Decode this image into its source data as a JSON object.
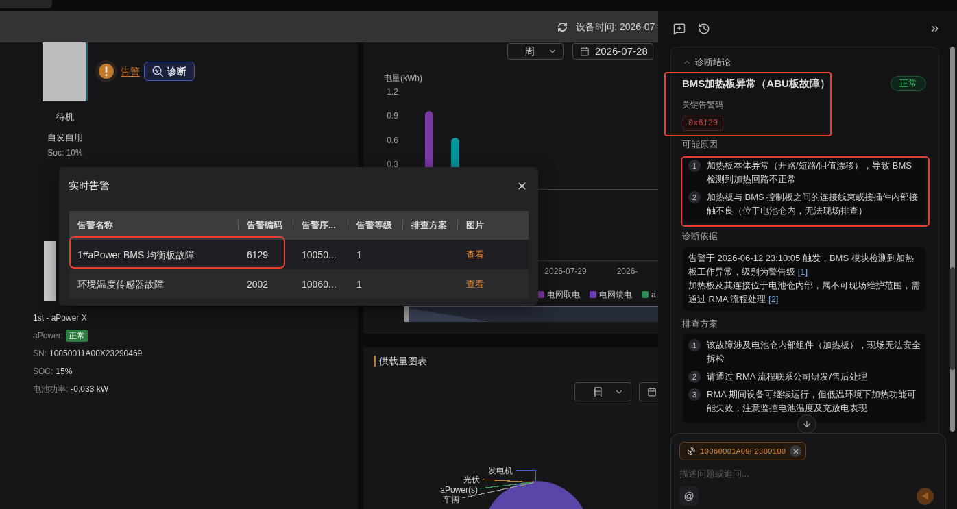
{
  "header": {
    "device_time": "设备时间: 2026-07-"
  },
  "device": {
    "alarm_link": "告警",
    "diagnose_button": "诊断",
    "state": "待机",
    "mode": "自发自用",
    "soc": "Soc: 10%"
  },
  "device_info": {
    "name": "1st - aPower X",
    "fields": [
      {
        "kind": "badge",
        "label": "aPower:",
        "value": "正常"
      },
      {
        "kind": "text",
        "label": "SN:",
        "value": "10050011A00X23290469"
      },
      {
        "kind": "text",
        "label": "SOC:",
        "value": "15%"
      },
      {
        "kind": "text",
        "label": "电池功率:",
        "value": "-0.033 kW"
      }
    ]
  },
  "energy_chart": {
    "period": "周",
    "date": "2026-07-28",
    "chart_data": {
      "type": "bar",
      "ylabel": "电量(kWh)",
      "categories": [
        null,
        null,
        "2026-07-29",
        "2026-"
      ],
      "ylim": [
        -0.9,
        1.2
      ],
      "yticks": [
        0.3,
        0.6,
        0.9,
        1.2
      ],
      "series": [
        {
          "name": "电网取电",
          "color": "#7b3aa3",
          "values": [
            0.96,
            null,
            null,
            null
          ]
        },
        {
          "name": "电网馈电",
          "color": "#6d3bb0",
          "values": [
            null,
            null,
            null,
            null
          ]
        },
        {
          "name": "a",
          "color": "#2e8b57",
          "values": [
            null,
            null,
            null,
            null
          ]
        },
        {
          "color": "#09969b",
          "values": [
            0.63,
            null,
            null,
            null
          ]
        }
      ]
    }
  },
  "load_chart": {
    "title": "供载量图表",
    "period": "日",
    "pie_labels": [
      {
        "label": "发电机",
        "color": "#2f6fd8"
      },
      {
        "label": "光伏",
        "color": "#c8823a"
      },
      {
        "label": "aPower(s)",
        "color": "#3aa055"
      },
      {
        "label": "车辆",
        "color": "#9a9a9a"
      }
    ]
  },
  "alarm_dialog": {
    "title": "实时告警",
    "columns": [
      "告警名称",
      "告警编码",
      "告警序...",
      "告警等级",
      "排查方案",
      "图片"
    ],
    "rows": [
      {
        "name": "1#aPower BMS 均衡板故障",
        "code": "6129",
        "column_3": "10050...",
        "grade": "1",
        "image_link": "查看",
        "highlighted": true
      },
      {
        "name": "环境温度传感器故障",
        "code": "2002",
        "column_3": "10060...",
        "grade": "1",
        "image_link": "查看",
        "highlighted": false
      }
    ]
  },
  "assistant": {
    "diagnosis": {
      "heading": "诊断结论",
      "expanded": true,
      "title": "BMS加热板异常（ABU板故障）",
      "status": "正常",
      "key_code_label": "关键告警码",
      "key_codes": [
        "0x6129"
      ],
      "highlighted": true,
      "causes": {
        "label": "可能原因",
        "highlighted": true,
        "items": [
          {
            "number": "1",
            "text": "加热板本体异常（开路/短路/阻值漂移），导致 BMS 检测到加热回路不正常"
          },
          {
            "number": "2",
            "text": "加热板与 BMS 控制板之间的连接线束或接插件内部接触不良（位于电池仓内，无法现场排查）"
          }
        ]
      },
      "basis": {
        "label": "诊断依据",
        "paragraphs": [
          {
            "text": "告警于 2026-06-12 23:10:05 触发，BMS 模块检测到加热板工作异常，级别为警告级",
            "citation": "[1]"
          },
          {
            "text": "加热板及其连接位于电池仓内部，属不可现场维护范围，需通过 RMA 流程处理",
            "citation": "[2]"
          }
        ]
      },
      "plan": {
        "label": "排查方案",
        "items": [
          {
            "number": "1",
            "text": "该故障涉及电池仓内部组件（加热板），现场无法安全拆检"
          },
          {
            "number": "2",
            "text": "请通过 RMA 流程联系公司研发/售后处理"
          },
          {
            "number": "3",
            "text": "RMA 期间设备可继续运行，但低温环境下加热功能可能失效，注意监控电池温度及充放电表现"
          }
        ]
      }
    },
    "composer": {
      "attachments": [
        {
          "label": "10060001A09F2380100"
        }
      ],
      "placeholder": "描述问题或追问...",
      "mention": "@",
      "send": {
        "disabled": true
      }
    }
  }
}
